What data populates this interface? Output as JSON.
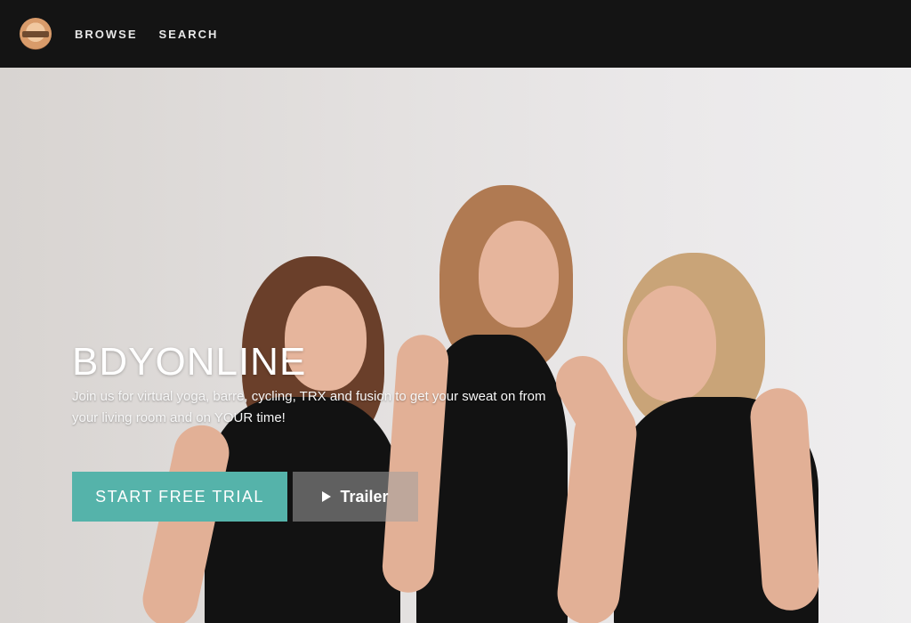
{
  "header": {
    "logo": "bdyonline-logo",
    "nav": [
      {
        "label": "BROWSE"
      },
      {
        "label": "SEARCH"
      }
    ]
  },
  "hero": {
    "title": "BDYONLINE",
    "description": "Join us for virtual yoga, barre, cycling, TRX and fusion to get your sweat on from your living room and on YOUR time!",
    "primary_button": "START FREE TRIAL",
    "secondary_button": "Trailer",
    "secondary_icon": "play-icon",
    "image": "three-women-laughing-photo"
  },
  "colors": {
    "header_bg": "#141414",
    "accent": "#55b3aa"
  }
}
